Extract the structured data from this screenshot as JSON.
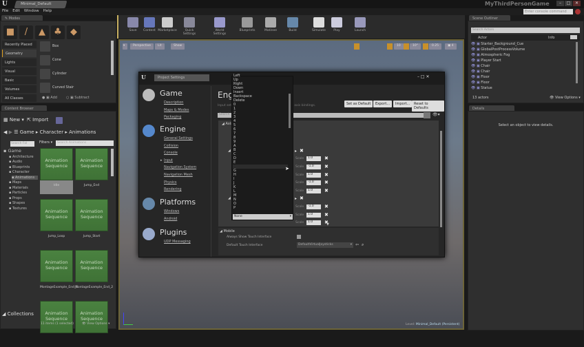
{
  "titlebar": {
    "tab": "Minimal_Default",
    "app_title": "MyThirdPersonGame",
    "minimize": "–",
    "maximize": "□",
    "close": "✕"
  },
  "menu": [
    "File",
    "Edit",
    "Window",
    "Help"
  ],
  "console": {
    "placeholder": "Enter console command"
  },
  "modes": {
    "tab": "Modes",
    "categories": [
      "Recently Placed",
      "Geometry",
      "Lights",
      "Visual",
      "Basic",
      "Volumes",
      "All Classes"
    ],
    "selected": "Geometry",
    "items": [
      "Box",
      "Cone",
      "Cylinder",
      "Curved Stair"
    ],
    "add": "Add",
    "subtract": "Subtract"
  },
  "toolbar": [
    "Save",
    "Content",
    "Marketplace",
    "Quick Settings",
    "World Settings",
    "Blueprints",
    "Matinee",
    "Build",
    "Simulate",
    "Play",
    "Launch"
  ],
  "viewport": {
    "perspective": "Perspective",
    "lit": "Lit",
    "show": "Show",
    "grid_snap": "10",
    "rot_snap": "10°",
    "scale_snap": "0.25",
    "camera_speed": "4",
    "level_label": "Level:",
    "level_name": "Minimal_Default (Persistent)"
  },
  "content_browser": {
    "tab": "Content Browser",
    "new": "New",
    "import": "Import",
    "path": [
      "Game",
      "Character",
      "Animations"
    ],
    "search_folders": "Search Fol",
    "filters": "Filters",
    "search_assets": "Search Animations",
    "tree": [
      "Game",
      "Architecture",
      "Audio",
      "Blueprints",
      "Character",
      "Animations",
      "Maps",
      "Materials",
      "Particles",
      "Props",
      "Shapes",
      "Textures"
    ],
    "collections": "Collections",
    "asset_type": "Animation Sequence",
    "assets": [
      "Idle",
      "Jump_End",
      "Jump_Loop",
      "Jump_Start",
      "MontageExample_End_1",
      "MontageExample_End_2",
      "",
      ""
    ],
    "status": "11 items (1 selected)",
    "view_options": "View Options"
  },
  "project_settings": {
    "tab": "Project Settings",
    "heading": "Engine - Input",
    "description": "Input settings, including default input action and axis bindings.",
    "buttons": [
      "Set as Default",
      "Export...",
      "Import...",
      "Reset to Defaults"
    ],
    "search_placeholder": "Search",
    "categories": [
      {
        "title": "Game",
        "links": [
          "Description",
          "Maps & Modes",
          "Packaging"
        ]
      },
      {
        "title": "Engine",
        "links": [
          "General Settings",
          "Collision",
          "Console",
          "Input",
          "Navigation System",
          "Navigation Mesh",
          "Physics",
          "Rendering"
        ]
      },
      {
        "title": "Platforms",
        "links": [
          "Windows",
          "Android"
        ]
      },
      {
        "title": "Plugins",
        "links": [
          "UDP Messaging"
        ]
      }
    ],
    "active_link": "Input",
    "axis_section": "Axis Mappings",
    "scale_label": "Scale",
    "scales": [
      "1.0",
      "-1.0",
      "1.0",
      "-1.0",
      "1.0",
      "-1.0",
      "1.0",
      "1.0",
      "1.0"
    ],
    "mobile": {
      "title": "Mobile",
      "always_show": "Always Show Touch Interface",
      "always_show_checked": false,
      "default_touch": "Default Touch Interface",
      "default_touch_value": "DefaultVirtualJoysticks"
    },
    "key_dropdown": {
      "items": [
        "Left",
        "Up",
        "Right",
        "Down",
        "Insert",
        "Backspace",
        "Delete",
        "0",
        "1",
        "2",
        "3",
        "4",
        "5",
        "6",
        "7",
        "8",
        "9",
        "A",
        "B",
        "C",
        "D",
        "E",
        "F",
        "G",
        "H",
        "I",
        "J",
        "K",
        "L",
        "M",
        "N",
        "O",
        "P"
      ],
      "selected": "None"
    }
  },
  "outliner": {
    "tab": "Scene Outliner",
    "search_placeholder": "Search Actors",
    "col_actor": "Actor",
    "col_info": "Info",
    "actors": [
      "Starter_Background_Cue",
      "GlobalPostProcessVolume",
      "Atmospheric Fog",
      "Player Start",
      "Chair",
      "Chair",
      "Floor",
      "Floor",
      "Statue"
    ],
    "count": "13 actors",
    "view_options": "View Options"
  },
  "details": {
    "tab": "Details",
    "empty": "Select an object to view details."
  },
  "colors": {
    "accent": "#e0a020",
    "asset_green": "#4a8240",
    "viewport_border": "#6d6438"
  }
}
